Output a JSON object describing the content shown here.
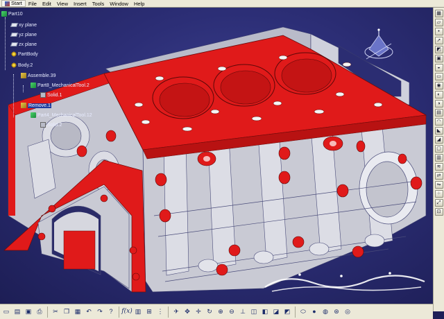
{
  "menu": {
    "start": "Start",
    "file": "File",
    "edit": "Edit",
    "view": "View",
    "insert": "Insert",
    "tools": "Tools",
    "window": "Window",
    "help": "Help"
  },
  "tree": {
    "root": "Part10",
    "xy": "xy plane",
    "yz": "yz plane",
    "zx": "zx plane",
    "partbody": "PartBody",
    "body2": "Body.2",
    "assemble": "Assemble.39",
    "tool2": "Part8_MechanicalTool.2",
    "solid1": "Solid.1",
    "remove": "Remove.1",
    "tool12": "Part4_MechanicalTool.12",
    "solid2": "Solid.2"
  },
  "watermark": {
    "text": "ایران اکونومیست"
  },
  "toolbar_bottom": {
    "fx": "f(x)"
  },
  "colors": {
    "menubar": "#ece9d8",
    "background": "#1e1f57",
    "selection_red": "#e01a1a",
    "part_grey": "#c9cad4"
  },
  "icons": {
    "right_toolbar": [
      "tile-icon",
      "plane-icon",
      "point-icon",
      "arrow-icon",
      "section-icon",
      "pocket-icon",
      "rib-icon",
      "slot-icon",
      "hole-icon",
      "groove-icon",
      "shaft-icon",
      "pad-icon",
      "fillet-icon",
      "chamfer-icon",
      "draft-icon",
      "shell-icon",
      "thickness-icon",
      "thread-icon",
      "translate-icon",
      "mirror-icon",
      "pattern-icon",
      "scale-icon",
      "measure-icon"
    ],
    "bottom_toolbar": [
      "new-icon",
      "open-icon",
      "save-icon",
      "print-icon",
      "cut-icon",
      "copy-icon",
      "paste-icon",
      "undo-icon",
      "redo-icon",
      "whatsthis-icon",
      "formula-icon",
      "sketcher-icon",
      "axis-icon",
      "tree-icon",
      "fly-icon",
      "fit-icon",
      "pan-icon",
      "rotate-icon",
      "zoom-in-icon",
      "zoom-out-icon",
      "normal-view-icon",
      "views-icon",
      "shading-icon",
      "hide-icon",
      "swap-icon",
      "cylinder-icon",
      "sphere-icon",
      "apply-material-icon",
      "select-icon",
      "navigate-icon"
    ]
  }
}
